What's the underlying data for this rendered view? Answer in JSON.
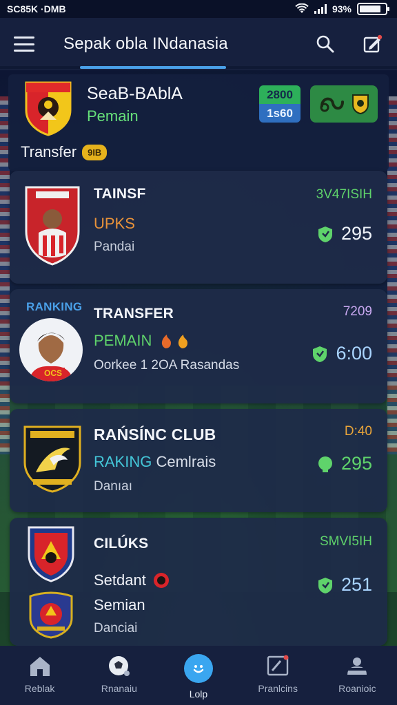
{
  "status_bar": {
    "left_text": "SC85K ·DMB",
    "battery_text": "93%"
  },
  "app_bar": {
    "title": "Sepak obla INdanasia",
    "icons": [
      "menu-icon",
      "search-icon",
      "edit-icon"
    ]
  },
  "header": {
    "title": "SeaB-BAblA",
    "subtitle": "Pemain",
    "score_top": "2800",
    "score_bottom": "1s60",
    "transfer_label": "Transfer",
    "transfer_badge": "9IB"
  },
  "cards": [
    {
      "title": "TAINSF",
      "line": "UPKS",
      "line_color": "#e8923a",
      "meta": "Pandai",
      "time": "3V47ISIH",
      "time_color": "#5fd36b",
      "score": "295"
    },
    {
      "ribbon": "RANKING",
      "title": "TRANSFER",
      "line": "PEMAIN",
      "line_color": "#5fd36b",
      "meta": "Oorkee 1 2OA Rasandas",
      "time": "7209",
      "time_color": "#c8a8f0",
      "score": "6:00",
      "jersey": "OCS"
    },
    {
      "title": "RAŃSÍNC CLUB",
      "line_a": "RAKING",
      "line_b": "Cemlrais",
      "line_color": "#44c6d8",
      "meta": "Danıaı",
      "time": "D:40",
      "time_color": "#e8a43a",
      "score": "295"
    },
    {
      "title": "CILÚKS",
      "line": "Setdant",
      "line2": "Semian",
      "meta": "Danciai",
      "time": "SMVI5IH",
      "time_color": "#5fd36b",
      "score": "251"
    }
  ],
  "bottom_nav": [
    {
      "label": "Reblak",
      "icon": "home-icon"
    },
    {
      "label": "Rnanaiu",
      "icon": "ball-icon"
    },
    {
      "label": "Lolp",
      "icon": "smile-icon",
      "active": true
    },
    {
      "label": "Pranlcins",
      "icon": "board-icon"
    },
    {
      "label": "Roanioic",
      "icon": "profile-icon"
    }
  ],
  "colors": {
    "accent": "#3aa6f0",
    "green": "#5fd36b",
    "card": "#1e2a48"
  }
}
